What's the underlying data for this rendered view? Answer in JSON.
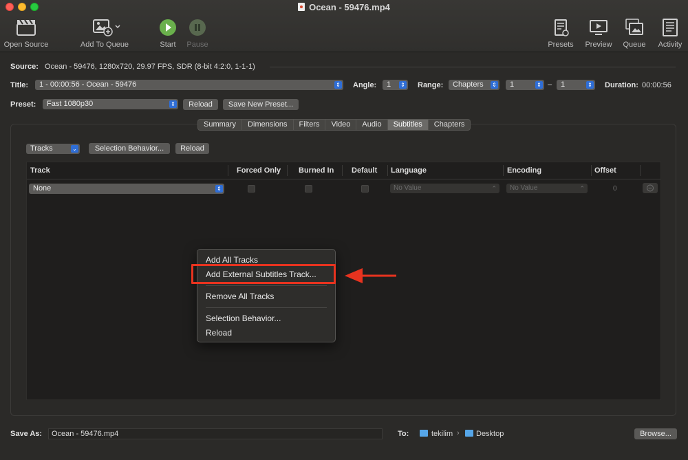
{
  "window": {
    "title": "Ocean - 59476.mp4"
  },
  "toolbar": {
    "open_source": "Open Source",
    "add_to_queue": "Add To Queue",
    "start": "Start",
    "pause": "Pause",
    "presets": "Presets",
    "preview": "Preview",
    "queue": "Queue",
    "activity": "Activity"
  },
  "source": {
    "label": "Source:",
    "value": "Ocean - 59476, 1280x720, 29.97 FPS, SDR (8-bit 4:2:0, 1-1-1)"
  },
  "title_row": {
    "label": "Title:",
    "value": "1 - 00:00:56 - Ocean - 59476",
    "angle_label": "Angle:",
    "angle_value": "1",
    "range_label": "Range:",
    "range_mode": "Chapters",
    "range_start": "1",
    "range_dash": "–",
    "range_end": "1",
    "duration_label": "Duration:",
    "duration_value": "00:00:56"
  },
  "preset_row": {
    "label": "Preset:",
    "value": "Fast 1080p30",
    "reload": "Reload",
    "save_new": "Save New Preset..."
  },
  "tabs": [
    "Summary",
    "Dimensions",
    "Filters",
    "Video",
    "Audio",
    "Subtitles",
    "Chapters"
  ],
  "active_tab": "Subtitles",
  "subtitles": {
    "tracks_popup": "Tracks",
    "selection_behavior": "Selection Behavior...",
    "reload": "Reload",
    "columns": [
      "Track",
      "Forced Only",
      "Burned In",
      "Default",
      "Language",
      "Encoding",
      "Offset"
    ],
    "row": {
      "track": "None",
      "language": "No Value",
      "encoding": "No Value",
      "offset": "0"
    }
  },
  "context_menu": {
    "items": [
      "Add All Tracks",
      "Add External Subtitles Track...",
      "Remove All Tracks",
      "Selection Behavior...",
      "Reload"
    ],
    "highlighted": "Add External Subtitles Track..."
  },
  "bottom": {
    "save_as_label": "Save As:",
    "save_as_value": "Ocean - 59476.mp4",
    "to_label": "To:",
    "path": [
      "tekilim",
      "Desktop"
    ],
    "path_sep": "›",
    "browse": "Browse..."
  },
  "colors": {
    "accent": "#2f6ed6",
    "annotation": "#e8331f",
    "start_green": "#6ab04c"
  }
}
